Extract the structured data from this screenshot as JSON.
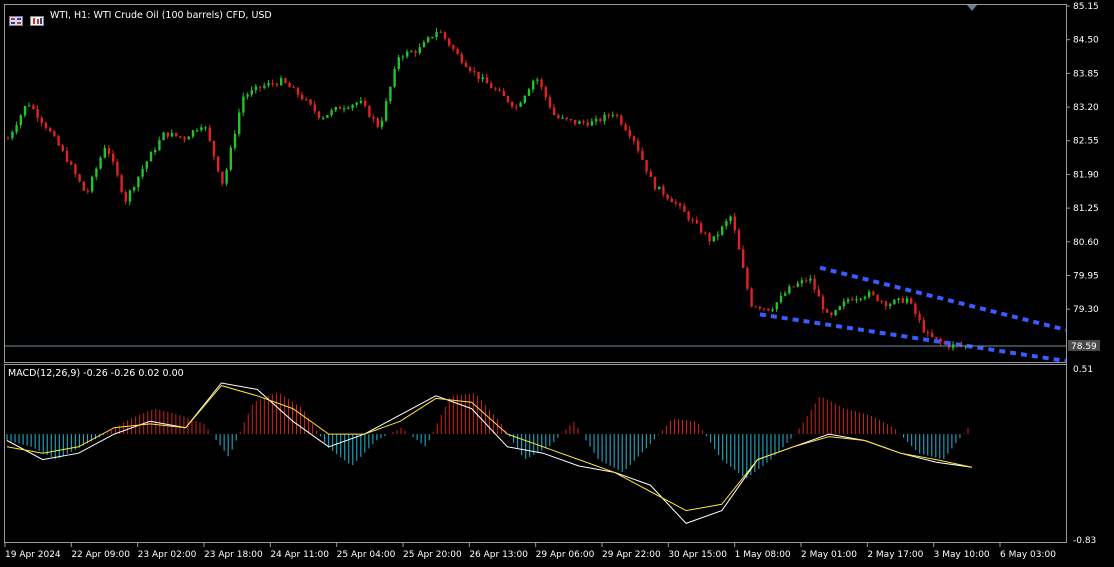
{
  "chart_header": {
    "symbol_text": "WTI, H1:  WTI Crude Oil (100 barrels) CFD, USD"
  },
  "indicator_header": {
    "text": "MACD(12,26,9) -0.26 -0.26 0.02 0.00"
  },
  "current_price_label": "78.59",
  "colors": {
    "background": "#000000",
    "bull": "#22c42a",
    "bear": "#e02222",
    "channel": "#3b5bff",
    "price_line": "#6f8fa6",
    "hist_pos": "#d22020",
    "hist_neg": "#27b8d6",
    "macd_line": "#ffffff",
    "signal_line": "#ffe23a",
    "axis_text": "#ffffff"
  },
  "icons": [
    "chart-grid-icon",
    "expert-icon"
  ],
  "chart_data": [
    {
      "type": "candlestick",
      "title": "WTI, H1:  WTI Crude Oil (100 barrels) CFD, USD",
      "ylim": [
        78.3,
        85.15
      ],
      "y_ticks": [
        "85.15",
        "84.50",
        "83.85",
        "83.20",
        "82.55",
        "81.90",
        "81.25",
        "80.60",
        "79.95",
        "79.30"
      ],
      "x_ticks": [
        "19 Apr 2024",
        "22 Apr 09:00",
        "23 Apr 02:00",
        "23 Apr 18:00",
        "24 Apr 11:00",
        "25 Apr 04:00",
        "25 Apr 20:00",
        "26 Apr 13:00",
        "29 Apr 06:00",
        "29 Apr 22:00",
        "30 Apr 15:00",
        "1 May 08:00",
        "2 May 01:00",
        "2 May 17:00",
        "3 May 10:00",
        "6 May 03:00"
      ],
      "close_path": [
        82.6,
        83.3,
        82.8,
        82.2,
        81.5,
        82.5,
        81.4,
        82.1,
        82.7,
        82.6,
        82.9,
        81.7,
        83.4,
        83.6,
        83.7,
        83.4,
        83.0,
        83.2,
        83.3,
        82.8,
        84.2,
        84.3,
        84.7,
        84.2,
        83.8,
        83.5,
        83.2,
        83.8,
        83.0,
        82.9,
        82.9,
        83.1,
        82.6,
        81.7,
        81.4,
        81.0,
        80.6,
        81.1,
        79.4,
        79.3,
        79.7,
        79.9,
        79.1,
        79.5,
        79.6,
        79.4,
        79.5,
        78.8,
        78.6,
        78.59
      ],
      "current_price": 78.59,
      "channel_lines": [
        {
          "name": "upper",
          "points": [
            [
              0,
              80.1
            ],
            [
              1,
              78.9
            ]
          ]
        },
        {
          "name": "lower",
          "points": [
            [
              0,
              79.2
            ],
            [
              1,
              78.3
            ]
          ]
        }
      ]
    },
    {
      "type": "macd",
      "title": "MACD(12,26,9) -0.26 -0.26 0.02 0.00",
      "ylim": [
        -0.83,
        0.51
      ],
      "y_ticks": [
        "0.51",
        "-0.83"
      ],
      "histogram": [
        -0.05,
        -0.1,
        -0.2,
        -0.1,
        0.0,
        0.12,
        0.2,
        0.15,
        0.08,
        -0.18,
        0.25,
        0.33,
        0.2,
        -0.1,
        -0.25,
        -0.05,
        0.05,
        -0.1,
        0.3,
        0.32,
        0.1,
        -0.2,
        -0.1,
        0.1,
        -0.2,
        -0.3,
        -0.1,
        0.12,
        0.1,
        -0.2,
        -0.35,
        -0.2,
        0.0,
        0.3,
        0.2,
        0.15,
        0.05,
        -0.15,
        -0.2,
        0.05
      ],
      "series": [
        {
          "name": "MACD",
          "values": [
            -0.05,
            -0.2,
            -0.15,
            0.0,
            0.1,
            0.05,
            0.4,
            0.35,
            0.1,
            -0.1,
            0.0,
            0.15,
            0.3,
            0.2,
            -0.1,
            -0.15,
            -0.25,
            -0.3,
            -0.4,
            -0.7,
            -0.6,
            -0.2,
            -0.1,
            0.0,
            -0.05,
            -0.15,
            -0.22,
            -0.26
          ]
        },
        {
          "name": "Signal",
          "values": [
            -0.1,
            -0.15,
            -0.1,
            0.05,
            0.08,
            0.05,
            0.38,
            0.3,
            0.2,
            0.0,
            0.0,
            0.1,
            0.28,
            0.25,
            0.0,
            -0.1,
            -0.2,
            -0.3,
            -0.45,
            -0.6,
            -0.55,
            -0.2,
            -0.1,
            -0.02,
            -0.05,
            -0.15,
            -0.2,
            -0.26
          ]
        }
      ]
    }
  ]
}
